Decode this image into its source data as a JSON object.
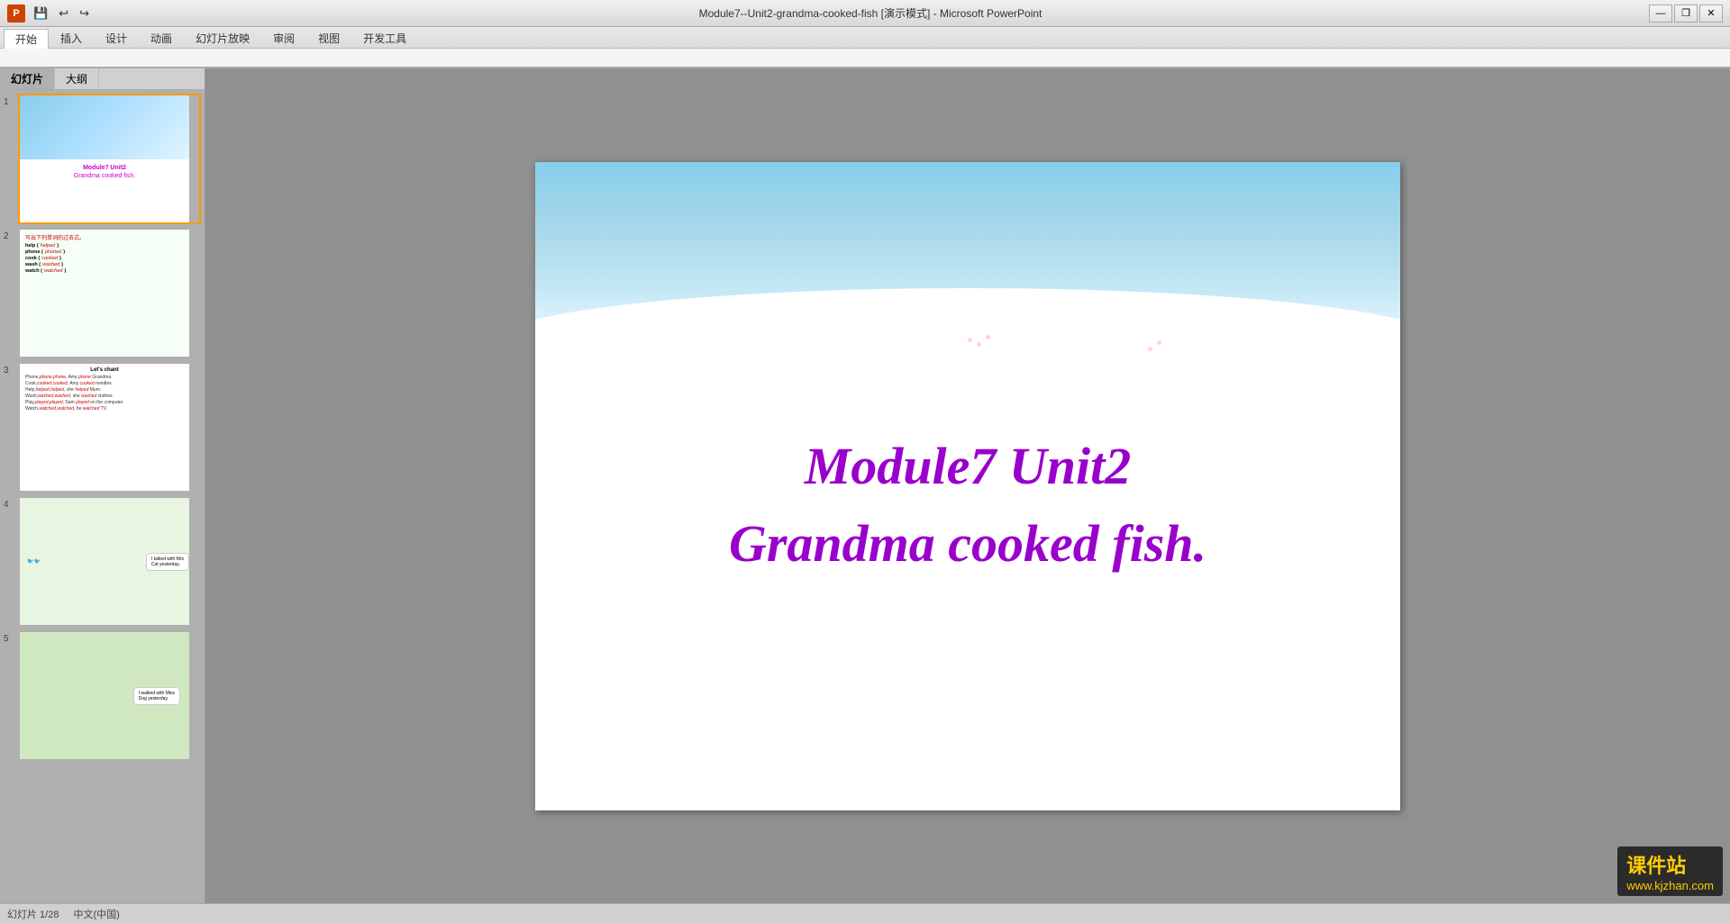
{
  "titlebar": {
    "appicon": "P",
    "title": "Module7--Unit2-grandma-cooked-fish [演示模式] - Microsoft PowerPoint",
    "quickaccess": [
      "save",
      "undo",
      "redo"
    ],
    "windowcontrols": [
      "minimize",
      "restore",
      "close"
    ]
  },
  "ribbon": {
    "tabs": [
      "开始",
      "插入",
      "设计",
      "动画",
      "幻灯片放映",
      "审阅",
      "视图",
      "开发工具"
    ]
  },
  "panel": {
    "tabs": [
      "幻灯片",
      "大纲"
    ],
    "active_tab": "幻灯片"
  },
  "slides": [
    {
      "num": "1",
      "title": "Module7  Unit2",
      "subtitle": "Grandma cooked fish.",
      "active": true
    },
    {
      "num": "2",
      "title": "写出下列单词的过去式。",
      "words": [
        {
          "base": "help",
          "past": "helped"
        },
        {
          "base": "phone",
          "past": "phoned"
        },
        {
          "base": "cook",
          "past": "cooked"
        },
        {
          "base": "wash",
          "past": "washed"
        },
        {
          "base": "watch",
          "past": "watched"
        }
      ]
    },
    {
      "num": "3",
      "title": "Let's chant",
      "lines": [
        "Phone,phone,phone, Amy phone Grandma.",
        "Cook,cooked,cooked, Amy cooked noodles.",
        "Help,helped,helped, she helped Mum.",
        "Wash,washed,washed, she washed clothes.",
        "Play,played,played, Sam played on the computer.",
        "Watch,watched,watched, he watched TV."
      ]
    },
    {
      "num": "4",
      "speech": "I talked with Mrs Cat yesterday."
    },
    {
      "num": "5",
      "speech": "I walked with Miss Dog yesterday."
    }
  ],
  "main_slide": {
    "title": "Module7  Unit2",
    "subtitle": "Grandma cooked fish."
  },
  "status": {
    "slide_count": "幻灯片 1/28",
    "theme": "",
    "language": "中文(中国)"
  },
  "watermark": {
    "main": "课件站",
    "sub": "www.kjzhan.com"
  }
}
